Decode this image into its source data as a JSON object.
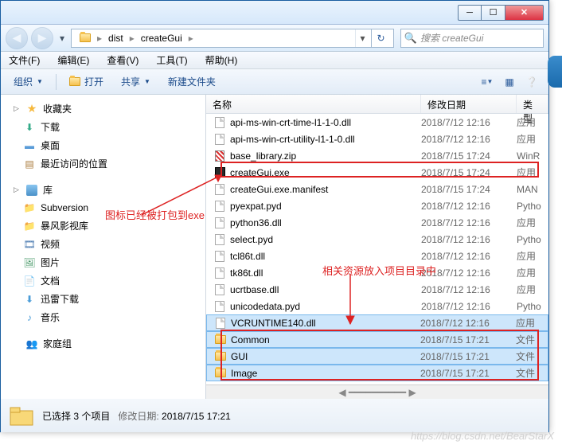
{
  "titlebar": {
    "min": "─",
    "max": "☐",
    "close": "✕"
  },
  "nav": {
    "back": "◀",
    "fwd": "▶",
    "dd": "▾"
  },
  "breadcrumb": {
    "items": [
      "dist",
      "createGui"
    ],
    "sep": "▸",
    "refresh": "↻"
  },
  "search": {
    "placeholder": "搜索 createGui",
    "icon": "🔍"
  },
  "menubar": [
    "文件(F)",
    "编辑(E)",
    "查看(V)",
    "工具(T)",
    "帮助(H)"
  ],
  "toolbar": {
    "organize": "组织",
    "open": "打开",
    "share": "共享",
    "newfolder": "新建文件夹",
    "dd": "▼"
  },
  "sidebar": {
    "favorites": {
      "label": "收藏夹",
      "items": [
        "下载",
        "桌面",
        "最近访问的位置"
      ]
    },
    "libraries": {
      "label": "库",
      "items": [
        "Subversion",
        "暴风影视库",
        "视频",
        "图片",
        "文档",
        "迅雷下载",
        "音乐"
      ]
    },
    "homegroup": "家庭组"
  },
  "columns": {
    "name": "名称",
    "date": "修改日期",
    "type": "类型"
  },
  "files": [
    {
      "name": "api-ms-win-crt-time-l1-1-0.dll",
      "date": "2018/7/12 12:16",
      "type": "应用",
      "icon": "dll"
    },
    {
      "name": "api-ms-win-crt-utility-l1-1-0.dll",
      "date": "2018/7/12 12:16",
      "type": "应用",
      "icon": "dll"
    },
    {
      "name": "base_library.zip",
      "date": "2018/7/15 17:24",
      "type": "WinR",
      "icon": "zip"
    },
    {
      "name": "createGui.exe",
      "date": "2018/7/15 17:24",
      "type": "应用",
      "icon": "exe",
      "hl": true
    },
    {
      "name": "createGui.exe.manifest",
      "date": "2018/7/15 17:24",
      "type": "MAN",
      "icon": "file"
    },
    {
      "name": "pyexpat.pyd",
      "date": "2018/7/12 12:16",
      "type": "Pytho",
      "icon": "pyd"
    },
    {
      "name": "python36.dll",
      "date": "2018/7/12 12:16",
      "type": "应用",
      "icon": "dll"
    },
    {
      "name": "select.pyd",
      "date": "2018/7/12 12:16",
      "type": "Pytho",
      "icon": "pyd"
    },
    {
      "name": "tcl86t.dll",
      "date": "2018/7/12 12:16",
      "type": "应用",
      "icon": "dll"
    },
    {
      "name": "tk86t.dll",
      "date": "2018/7/12 12:16",
      "type": "应用",
      "icon": "dll"
    },
    {
      "name": "ucrtbase.dll",
      "date": "2018/7/12 12:16",
      "type": "应用",
      "icon": "dll"
    },
    {
      "name": "unicodedata.pyd",
      "date": "2018/7/12 12:16",
      "type": "Pytho",
      "icon": "pyd"
    },
    {
      "name": "VCRUNTIME140.dll",
      "date": "2018/7/12 12:16",
      "type": "应用",
      "icon": "dll",
      "sel": true
    },
    {
      "name": "Common",
      "date": "2018/7/15 17:21",
      "type": "文件",
      "icon": "folder",
      "sel": true,
      "hl2": true
    },
    {
      "name": "GUI",
      "date": "2018/7/15 17:21",
      "type": "文件",
      "icon": "folder",
      "sel": true,
      "hl2": true
    },
    {
      "name": "Image",
      "date": "2018/7/15 17:21",
      "type": "文件",
      "icon": "folder",
      "sel": true,
      "hl2": true
    }
  ],
  "status": {
    "selected": "已选择 3 个项目",
    "modlabel": "修改日期:",
    "moddate": "2018/7/15 17:21"
  },
  "annotations": {
    "exe_note": "图标已经被打包到exe",
    "res_note": "相关资源放入项目目录中"
  },
  "watermark": "https://blog.csdn.net/BearStarX"
}
